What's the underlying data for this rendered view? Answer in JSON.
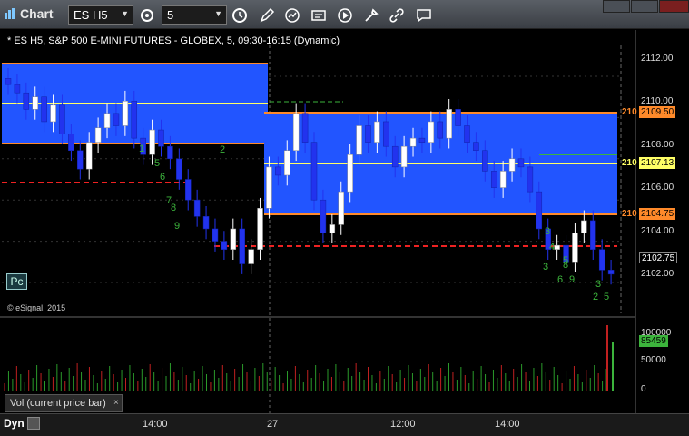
{
  "window": {
    "title": "Chart",
    "symbol": "ES H5",
    "interval": "5"
  },
  "chart": {
    "header": "* ES H5, S&P 500 E-MINI FUTURES - GLOBEX, 5, 09:30-16:15 (Dynamic)",
    "copyright": "© eSignal, 2015",
    "pc_label": "Pc",
    "volume_label": "Vol (current price bar)",
    "volume_close": "×",
    "dyn_label": "Dyn",
    "price_axis": [
      "2112.00",
      "2110.00",
      "2108.00",
      "2106.00",
      "2104.00",
      "2102.00"
    ],
    "volume_axis": [
      "100000",
      "50000",
      "0"
    ],
    "time_axis": [
      "14:00",
      "27",
      "12:00",
      "14:00"
    ],
    "tags": {
      "upper_band": "2109.50",
      "mid": "2107.13",
      "lower_band": "2104.75",
      "last": "2102.75",
      "volume": "85459",
      "prefix": "210"
    },
    "colors": {
      "band": "#2255ff",
      "up_candle": "#ffffff",
      "down_candle": "#2233ee",
      "orange": "#ff8a2a",
      "yellow": "#ffff66",
      "red_dash": "#ee2222",
      "green": "#3cb43c"
    }
  },
  "chart_data": {
    "type": "line",
    "ylim": [
      2100.5,
      2113.5
    ],
    "series": [
      {
        "name": "",
        "values": [
          2111.6,
          2111.2,
          2110.4,
          2111.0,
          2109.8,
          2110.6,
          2109.2,
          2108.4,
          2107.5,
          2108.8,
          2109.5,
          2110.2,
          2109.6,
          2110.8,
          2109.0,
          2108.2,
          2109.4,
          2108.6,
          2108.0,
          2107.0,
          2106.0,
          2105.2,
          2104.6,
          2104.0,
          2103.6,
          2104.6,
          2102.9,
          2103.6,
          2105.6,
          2107.6,
          2107.2,
          2108.4,
          2110.2,
          2108.8,
          2106.0,
          2104.4,
          2104.8,
          2106.4,
          2108.2,
          2109.6,
          2108.8,
          2109.8,
          2108.6,
          2107.6,
          2108.6,
          2109.0,
          2108.8,
          2109.8,
          2109.0,
          2110.4,
          2109.6,
          2108.8,
          2108.4,
          2107.4,
          2106.6,
          2107.4,
          2108.0,
          2107.6,
          2106.4,
          2104.6,
          2103.6,
          2103.8,
          2103.0,
          2104.4,
          2105.0,
          2103.6,
          2102.6,
          2102.4
        ]
      }
    ]
  }
}
